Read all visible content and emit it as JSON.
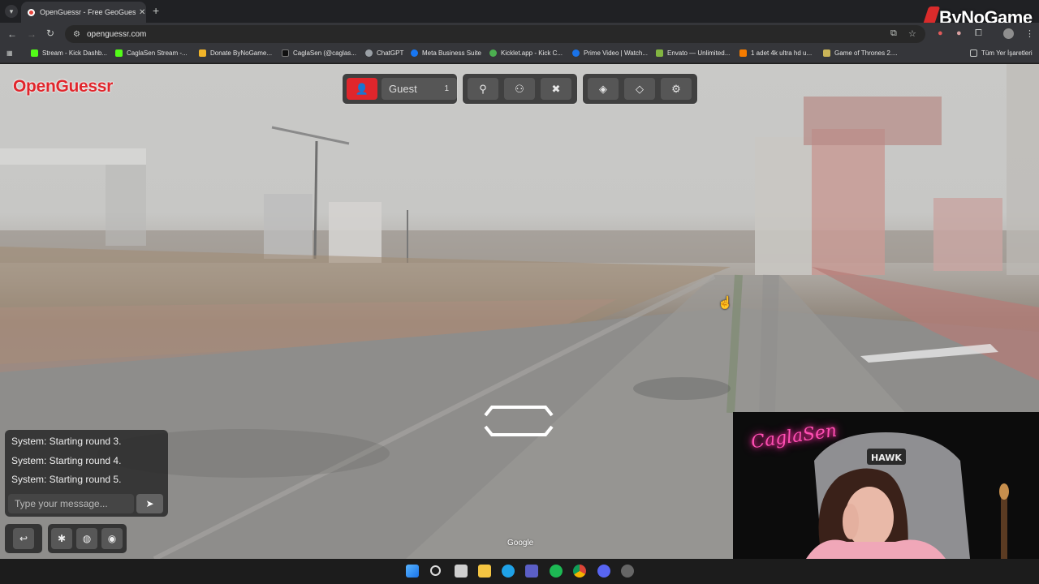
{
  "browser": {
    "tab_title": "OpenGuessr - Free GeoGuessr Alternative",
    "url": "openguessr.com",
    "bookmarks": [
      "Stream - Kick Dashb...",
      "CaglaSen Stream -...",
      "Donate ByNoGame...",
      "CaglaSen (@caglas...",
      "ChatGPT",
      "Meta Business Suite",
      "Kicklet.app - Kick C...",
      "Prime Video | Watch...",
      "Envato — Unlimited...",
      "1 adet 4k ultra hd u...",
      "Game of Thrones 2...."
    ],
    "all_bookmarks": "Tüm Yer İşaretleri",
    "overlay_brand": "ByNoGame"
  },
  "game": {
    "logo": "OpenGuessr",
    "player_name": "Guest",
    "player_count": "1",
    "accent_color": "#e0262c"
  },
  "chat": {
    "messages": [
      "System: Starting round 3.",
      "System: Starting round 4.",
      "System: Starting round 5."
    ],
    "input_placeholder": "Type your message..."
  },
  "streetview": {
    "attribution": "Google"
  },
  "webcam": {
    "neon_sign": "CaglaSen",
    "headset_brand": "HAWK"
  }
}
